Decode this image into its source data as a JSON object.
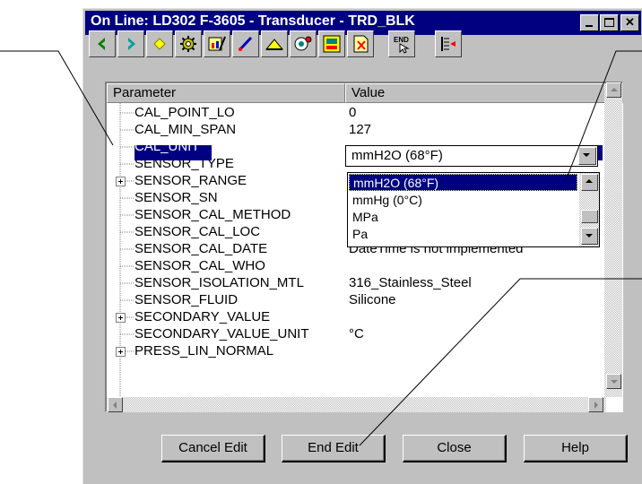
{
  "window": {
    "title": "On Line: LD302 F-3605 - Transducer - TRD_BLK",
    "caption_buttons": [
      "minimize",
      "maximize",
      "close"
    ]
  },
  "toolbar": {
    "icons": [
      "back-arrow-icon",
      "forward-arrow-icon",
      "diamond-icon",
      "gear-icon",
      "chart-edit-icon",
      "calibrate-pen-icon",
      "gauge-icon",
      "camera-icon",
      "monitor-icon",
      "document-icon",
      "end-icon",
      "list-arrow-icon"
    ],
    "end_label": "END"
  },
  "grid": {
    "columns": [
      "Parameter",
      "Value"
    ],
    "rows": [
      {
        "name": "CAL_POINT_LO",
        "value": "0",
        "expandable": false
      },
      {
        "name": "CAL_MIN_SPAN",
        "value": "127",
        "expandable": false
      },
      {
        "name": "CAL_UNIT",
        "value": "",
        "expandable": false,
        "selected": true
      },
      {
        "name": "SENSOR_TYPE",
        "value": "",
        "expandable": false
      },
      {
        "name": "SENSOR_RANGE",
        "value": "",
        "expandable": true
      },
      {
        "name": "SENSOR_SN",
        "value": "",
        "expandable": false
      },
      {
        "name": "SENSOR_CAL_METHOD",
        "value": "",
        "expandable": false
      },
      {
        "name": "SENSOR_CAL_LOC",
        "value": "",
        "expandable": false
      },
      {
        "name": "SENSOR_CAL_DATE",
        "value": "DateTime is not implemented",
        "expandable": false
      },
      {
        "name": "SENSOR_CAL_WHO",
        "value": "",
        "expandable": false
      },
      {
        "name": "SENSOR_ISOLATION_MTL",
        "value": "316_Stainless_Steel",
        "expandable": false
      },
      {
        "name": "SENSOR_FLUID",
        "value": "Silicone",
        "expandable": false
      },
      {
        "name": "SECONDARY_VALUE",
        "value": "",
        "expandable": true
      },
      {
        "name": "SECONDARY_VALUE_UNIT",
        "value": "°C",
        "expandable": false
      },
      {
        "name": "PRESS_LIN_NORMAL",
        "value": "",
        "expandable": true
      }
    ]
  },
  "dropdown": {
    "current_value": "mmH2O (68°F)",
    "options": [
      "mmH2O (68°F)",
      "mmHg (0°C)",
      "MPa",
      "Pa"
    ],
    "highlighted_index": 0
  },
  "buttons": {
    "cancel_edit": "Cancel Edit",
    "end_edit": "End Edit",
    "close": "Close",
    "help": "Help"
  },
  "colors": {
    "title_bar": "#000080",
    "selection": "#000080",
    "face": "#c0c0c0"
  }
}
